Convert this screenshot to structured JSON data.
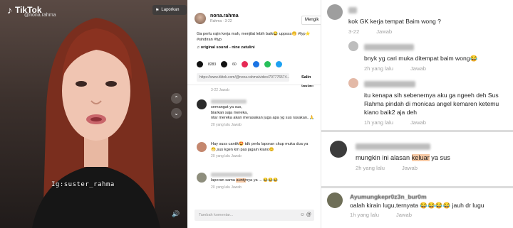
{
  "video": {
    "brand": "TikTok",
    "handle": "@nona.rahma",
    "caption": "Ig:suster_rahma",
    "report_label": "Laporkan"
  },
  "detail": {
    "username": "nona.rahma",
    "sub": "Rahma · 3-22",
    "follow_label": "Mengik",
    "description": "Ga perlu rajin kerja mah, menjilat lebih baik😂 uppsss🤭 #fyp⭐ #sindiran #fyp",
    "sound": "original sound - nine zatulini",
    "likes": "8283",
    "comments": "60",
    "url": "https://www.tiktok.com/@nona.rahma/video/707776574...",
    "copy_label": "Salin tautan",
    "comments_list": [
      {
        "meta": "3-22   Jawab",
        "text": ""
      },
      {
        "text": "semangat ya sus,\nbiarkan saja mereka,\nntar mereka akan merasakan juga apa yg sus rasakan..🙏",
        "meta": "20 yang lalu   Jawab"
      },
      {
        "text": "Hay suss cantik🤩 tdk perlu laporan ckup muka dua ya 😁,sus kgen km pas jagain kiano😊",
        "meta": "20 yang lalu   Jawab"
      },
      {
        "text_pre": "laporan sama ",
        "highlight": "aunty",
        "text_post": "nya ya ... 😂😂😂",
        "meta": "20 yang lalu   Jawab"
      }
    ],
    "input_placeholder": "Tambah komentar..."
  },
  "zoom1": {
    "c1_text": "kok GK kerja tempat Baim wong ?",
    "c1_meta": [
      "3-22",
      "Jawab"
    ],
    "c2_text": "bnyk yg cari muka ditempat baim wong😂",
    "c2_meta": [
      "2h yang lalu",
      "Jawab"
    ],
    "c3_text": "itu kenapa sih sebenernya aku ga ngeeh deh Sus Rahma pindah di monicas angel kemaren ketemu kiano baik2 aja deh",
    "c3_meta": [
      "1h yang lalu",
      "Jawab"
    ]
  },
  "zoom2": {
    "text_pre": "mungkin ini alasan ",
    "highlight": "keluar",
    "text_post": " ya sus",
    "meta": [
      "2h yang lalu",
      "Jawab"
    ]
  },
  "zoom3": {
    "name": "Ayumungkepr0z3n_bur0m",
    "text": "oalah kirain lugu,ternyata 😂😂😂😂 jauh dr lugu",
    "meta": [
      "1h yang lalu",
      "Jawab"
    ]
  }
}
